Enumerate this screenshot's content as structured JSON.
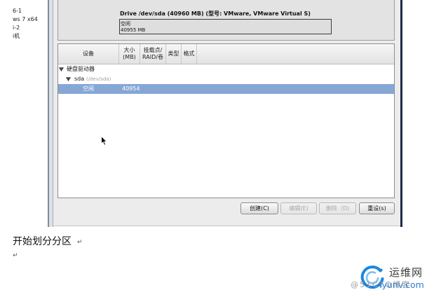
{
  "colors": {
    "window_bg": "#ececec",
    "selection_bg": "#86a7d6",
    "watermark_blue": "#2b7fd6"
  },
  "icons": {
    "tree_expander": "triangle-down-icon",
    "pointer": "mouse-pointer-icon",
    "watermark_logo": "swirl-logo-icon"
  },
  "document": {
    "side_fragments": [
      "6-1",
      "ws 7 x64",
      "i-2",
      "i机"
    ],
    "caption": "开始划分分区",
    "paragraph_marks": [
      "↵",
      "↵"
    ]
  },
  "installer": {
    "drive": {
      "label": "Drive /dev/sda (40960 MB) (型号: VMware, VMware Virtual S)",
      "segments": [
        {
          "label": "空闲",
          "size": "40955 MB"
        }
      ]
    },
    "table": {
      "columns": [
        {
          "lines": [
            "设备"
          ]
        },
        {
          "lines": [
            "大小",
            "(MB)"
          ]
        },
        {
          "lines": [
            "挂载点/",
            "RAID/卷"
          ]
        },
        {
          "lines": [
            "类型"
          ]
        },
        {
          "lines": [
            "格式"
          ]
        }
      ],
      "rows": [
        {
          "device": "硬盘驱动器",
          "expanded": true,
          "selected": false
        },
        {
          "device": "sda",
          "path": "(/dev/sda)",
          "expanded": true,
          "selected": false
        },
        {
          "device": "空闲",
          "size": "40954",
          "selected": true
        }
      ]
    },
    "buttons": [
      {
        "label": "创建(C)",
        "enabled": true
      },
      {
        "label": "编辑(E)",
        "enabled": false
      },
      {
        "label": "删除（D)",
        "enabled": false
      },
      {
        "label": "重设(s)",
        "enabled": true
      }
    ]
  },
  "watermark": {
    "site_name": "运维网",
    "blog_credit": "@51CTO博客",
    "site_domain": "iyunv.com"
  }
}
